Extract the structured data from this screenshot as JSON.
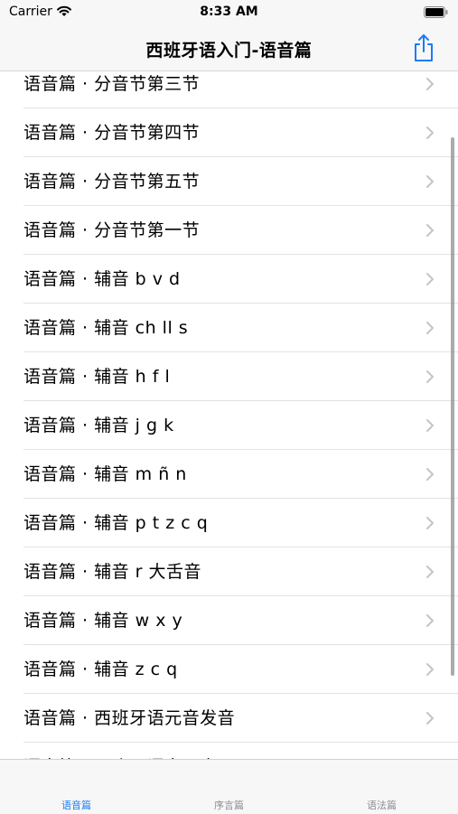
{
  "status_bar": {
    "carrier": "Carrier",
    "time": "8:33 AM"
  },
  "nav": {
    "title": "西班牙语入门-语音篇",
    "share_icon": "share-icon"
  },
  "list": {
    "items": [
      {
        "label": "语音篇 · 分音节第三节"
      },
      {
        "label": "语音篇 · 分音节第四节"
      },
      {
        "label": "语音篇 · 分音节第五节"
      },
      {
        "label": "语音篇 · 分音节第一节"
      },
      {
        "label": "语音篇 · 辅音 b v d"
      },
      {
        "label": "语音篇 · 辅音 ch ll s"
      },
      {
        "label": "语音篇 · 辅音 h f l"
      },
      {
        "label": "语音篇 · 辅音 j g k"
      },
      {
        "label": "语音篇 · 辅音 m ñ n"
      },
      {
        "label": "语音篇 · 辅音 p t z c q"
      },
      {
        "label": "语音篇 · 辅音 r 大舌音"
      },
      {
        "label": "语音篇 · 辅音 w x y"
      },
      {
        "label": "语音篇 · 辅音 z c q"
      },
      {
        "label": "语音篇 · 西班牙语元音发音"
      },
      {
        "label": "语音篇 · 西班牙语字母表"
      }
    ]
  },
  "tabs": [
    {
      "label": "语音篇",
      "selected": true
    },
    {
      "label": "序言篇",
      "selected": false
    },
    {
      "label": "语法篇",
      "selected": false
    }
  ],
  "colors": {
    "accent": "#1a7cf5",
    "inactive": "#8e8e93",
    "separator": "#e3e3e6",
    "chevron": "#c4c4c7"
  }
}
